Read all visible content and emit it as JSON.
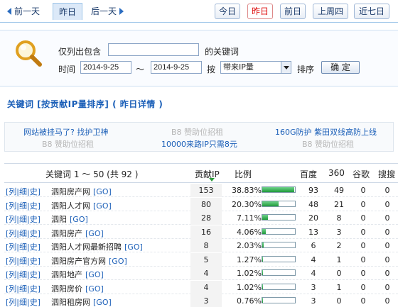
{
  "nav": {
    "prev": "前一天",
    "current": "昨日",
    "next": "后一天",
    "tabs": [
      "今日",
      "昨日",
      "前日",
      "上周四",
      "近七日"
    ],
    "active_tab": "昨日"
  },
  "search": {
    "label_contains": "仅列出包含",
    "label_keyword": "的关键词",
    "keyword_value": "",
    "label_time": "时间",
    "date_from": "2014-9-25",
    "tilde": "～",
    "date_to": "2014-9-25",
    "label_by": "按",
    "sort_select": "带来IP量",
    "label_sort": "排序",
    "ok_button": "确 定"
  },
  "heading": "关键词 [按贡献IP量排序] ( 昨日详情 )",
  "ads": {
    "a1": "网站被挂马了? 找护卫神",
    "a2": "B8 赞助位招租",
    "a3": "160G防护 紫田双线高防上线",
    "a4": "B8 赞助位招租",
    "a5": "10000来路IP只需8元",
    "a6": "B8 赞助位招租"
  },
  "table": {
    "headers": {
      "keyword": "关键词 1 ～ 50 (共 92 )",
      "contrib": "贡献IP",
      "ratio": "比例",
      "baidu": "百度",
      "s360": "360",
      "google": "谷歌",
      "sogou": "搜搜"
    },
    "links_text": "[列|细|史]",
    "go_text": "[GO]",
    "rows": [
      {
        "keyword": "泗阳房产网",
        "contrib": "153",
        "pct": "38.83%",
        "ratio": 0.3883,
        "baidu": "93",
        "s360": "49",
        "google": "0",
        "sogou": "0"
      },
      {
        "keyword": "泗阳人才网",
        "contrib": "80",
        "pct": "20.30%",
        "ratio": 0.203,
        "baidu": "48",
        "s360": "21",
        "google": "0",
        "sogou": "0"
      },
      {
        "keyword": "泗阳",
        "contrib": "28",
        "pct": "7.11%",
        "ratio": 0.0711,
        "baidu": "20",
        "s360": "8",
        "google": "0",
        "sogou": "0"
      },
      {
        "keyword": "泗阳房产",
        "contrib": "16",
        "pct": "4.06%",
        "ratio": 0.0406,
        "baidu": "13",
        "s360": "3",
        "google": "0",
        "sogou": "0"
      },
      {
        "keyword": "泗阳人才网最新招聘",
        "contrib": "8",
        "pct": "2.03%",
        "ratio": 0.0203,
        "baidu": "6",
        "s360": "2",
        "google": "0",
        "sogou": "0"
      },
      {
        "keyword": "泗阳房产官方网",
        "contrib": "5",
        "pct": "1.27%",
        "ratio": 0.0127,
        "baidu": "4",
        "s360": "1",
        "google": "0",
        "sogou": "0"
      },
      {
        "keyword": "泗阳地产",
        "contrib": "4",
        "pct": "1.02%",
        "ratio": 0.0102,
        "baidu": "4",
        "s360": "0",
        "google": "0",
        "sogou": "0"
      },
      {
        "keyword": "泗阳房价",
        "contrib": "4",
        "pct": "1.02%",
        "ratio": 0.0102,
        "baidu": "3",
        "s360": "1",
        "google": "0",
        "sogou": "0"
      },
      {
        "keyword": "泗阳租房网",
        "contrib": "3",
        "pct": "0.76%",
        "ratio": 0.0076,
        "baidu": "3",
        "s360": "0",
        "google": "0",
        "sogou": "0"
      }
    ]
  },
  "colors": {
    "link_blue": "#1b5fb8",
    "bar_green": "#1f9a3a",
    "active_red": "#dd0000"
  }
}
